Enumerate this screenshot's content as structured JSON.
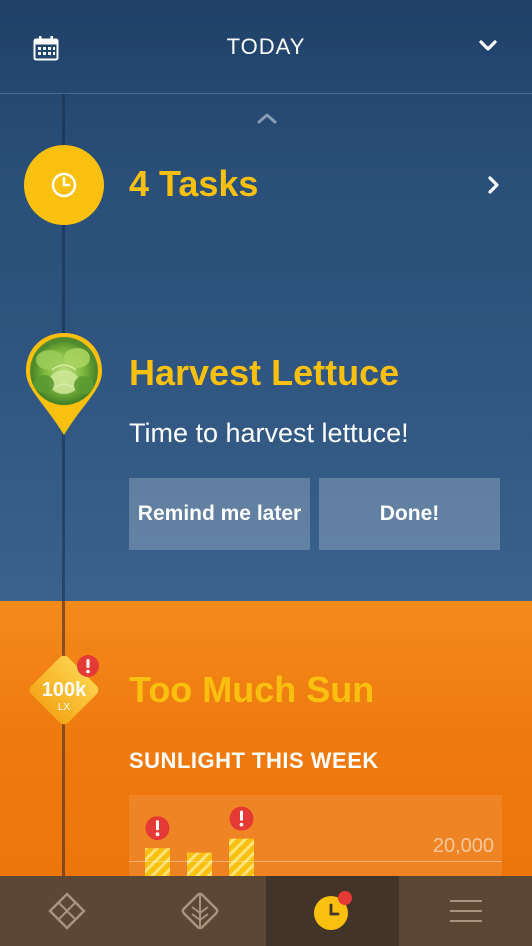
{
  "header": {
    "title": "TODAY",
    "calendar_icon": "calendar-icon",
    "dropdown_icon": "chevron-down-icon"
  },
  "timeline": {
    "tasks": {
      "count_label": "4 Tasks",
      "icon": "clock-icon"
    },
    "harvest": {
      "title": "Harvest Lettuce",
      "description": "Time to harvest lettuce!",
      "remind_label": "Remind me later",
      "done_label": "Done!",
      "icon": "lettuce-pin-icon"
    },
    "sun": {
      "badge_value": "100k",
      "badge_unit": "LX",
      "title": "Too Much Sun",
      "subtitle": "SUNLIGHT THIS WEEK"
    }
  },
  "chart_data": {
    "type": "bar",
    "title": "SUNLIGHT THIS WEEK",
    "reference_line": {
      "value": 20000,
      "label": "20,000"
    },
    "categories": [
      "",
      "",
      ""
    ],
    "values": [
      24000,
      20300,
      32000
    ],
    "warnings": [
      true,
      false,
      true
    ],
    "ylim": [
      0,
      40000
    ],
    "grid": false,
    "colors": {
      "bar": "#fac00f",
      "over": "#fac00f"
    }
  },
  "nav": {
    "tabs": [
      {
        "icon": "diamond-grid-icon",
        "active": false
      },
      {
        "icon": "leaf-icon",
        "active": false
      },
      {
        "icon": "clock-icon",
        "active": true,
        "badge": true
      },
      {
        "icon": "menu-icon",
        "active": false
      }
    ]
  },
  "colors": {
    "accent": "#fac00f",
    "blue_bg": "#2d5278",
    "orange_bg": "#ef7a0e",
    "alert": "#e53935",
    "nav_bg": "#5e4634"
  }
}
